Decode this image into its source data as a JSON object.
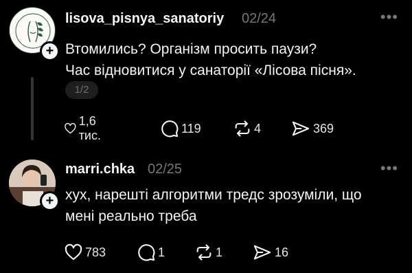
{
  "posts": [
    {
      "username": "lisova_pisnya_sanatoriy",
      "date": "02/24",
      "text_lines": [
        "Втомились? Організм просить паузи?",
        "Час відновитися у санаторії «Лісова пісня»."
      ],
      "pager": "1/2",
      "likes": "1,6 тис.",
      "replies": "119",
      "reposts": "4",
      "shares": "369"
    },
    {
      "username": "marri.chka",
      "date": "02/25",
      "text_lines": [
        "хух, нарешті алгоритми тредс зрозуміли, що",
        "мені реально треба"
      ],
      "likes": "783",
      "replies": "1",
      "reposts": "1",
      "shares": "16"
    }
  ],
  "icons": {
    "like": "heart-icon",
    "reply": "comment-icon",
    "repost": "repost-icon",
    "share": "send-icon",
    "follow": "plus-icon",
    "more": "more-icon"
  },
  "colors": {
    "background": "#000000",
    "text": "#f3f5f7",
    "muted": "#777777"
  }
}
